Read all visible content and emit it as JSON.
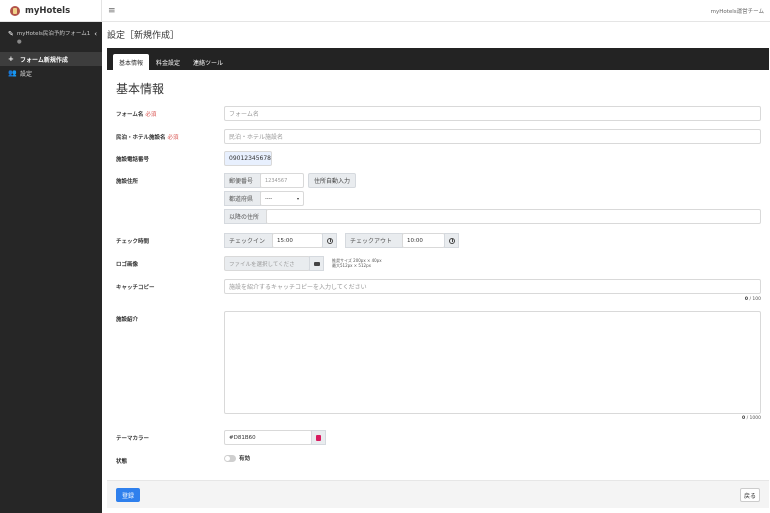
{
  "brand": {
    "name": "myHotels",
    "logo_icon": "hotel-logo-icon"
  },
  "sidebar": {
    "form_title": "myHotels民泊予約フォーム1",
    "form_status": "●",
    "items": [
      {
        "label": "フォーム新規作成",
        "icon": "plus-icon",
        "active": true
      },
      {
        "label": "設定",
        "icon": "users-icon",
        "active": false
      }
    ]
  },
  "header": {
    "menu_icon": "hamburger-icon",
    "team": "myHotels運営チーム"
  },
  "page": {
    "title": "設定［新規作成］"
  },
  "tabs": [
    {
      "label": "基本情報",
      "active": true
    },
    {
      "label": "料金設定",
      "active": false
    },
    {
      "label": "連絡ツール",
      "active": false
    }
  ],
  "section_title": "基本情報",
  "form": {
    "form_name": {
      "label": "フォーム名",
      "required": "必須",
      "placeholder": "フォーム名"
    },
    "facility_name": {
      "label": "民泊・ホテル施設名",
      "required": "必須",
      "placeholder": "民泊・ホテル施設名"
    },
    "phone": {
      "label": "施設電話番号",
      "value": "09012345678"
    },
    "address": {
      "label": "施設住所",
      "postal_label": "郵便番号",
      "postal_placeholder": "1234567",
      "auto_button": "住所自動入力",
      "prefecture_label": "都道府県",
      "prefecture_value": "----",
      "rest_label": "以降の住所"
    },
    "checkin": {
      "label": "チェック時間",
      "in_label": "チェックイン",
      "in_value": "15:00",
      "out_label": "チェックアウト",
      "out_value": "10:00"
    },
    "logo": {
      "label": "ロゴ画像",
      "placeholder": "ファイルを選択してくださ",
      "hint1": "推奨サイズ 200px × 40px",
      "hint2": "最大512px × 512px"
    },
    "catch": {
      "label": "キャッチコピー",
      "placeholder": "施設を紹介するキャッチコピーを入力してください",
      "count": "0",
      "max": "/ 100"
    },
    "intro": {
      "label": "施設紹介",
      "count": "0",
      "max": "/ 1000"
    },
    "theme": {
      "label": "テーマカラー",
      "value": "#D81B60",
      "color": "#D81B60"
    },
    "status": {
      "label": "状態",
      "toggle_label": "有効"
    }
  },
  "footer": {
    "submit": "登録",
    "back": "戻る"
  }
}
